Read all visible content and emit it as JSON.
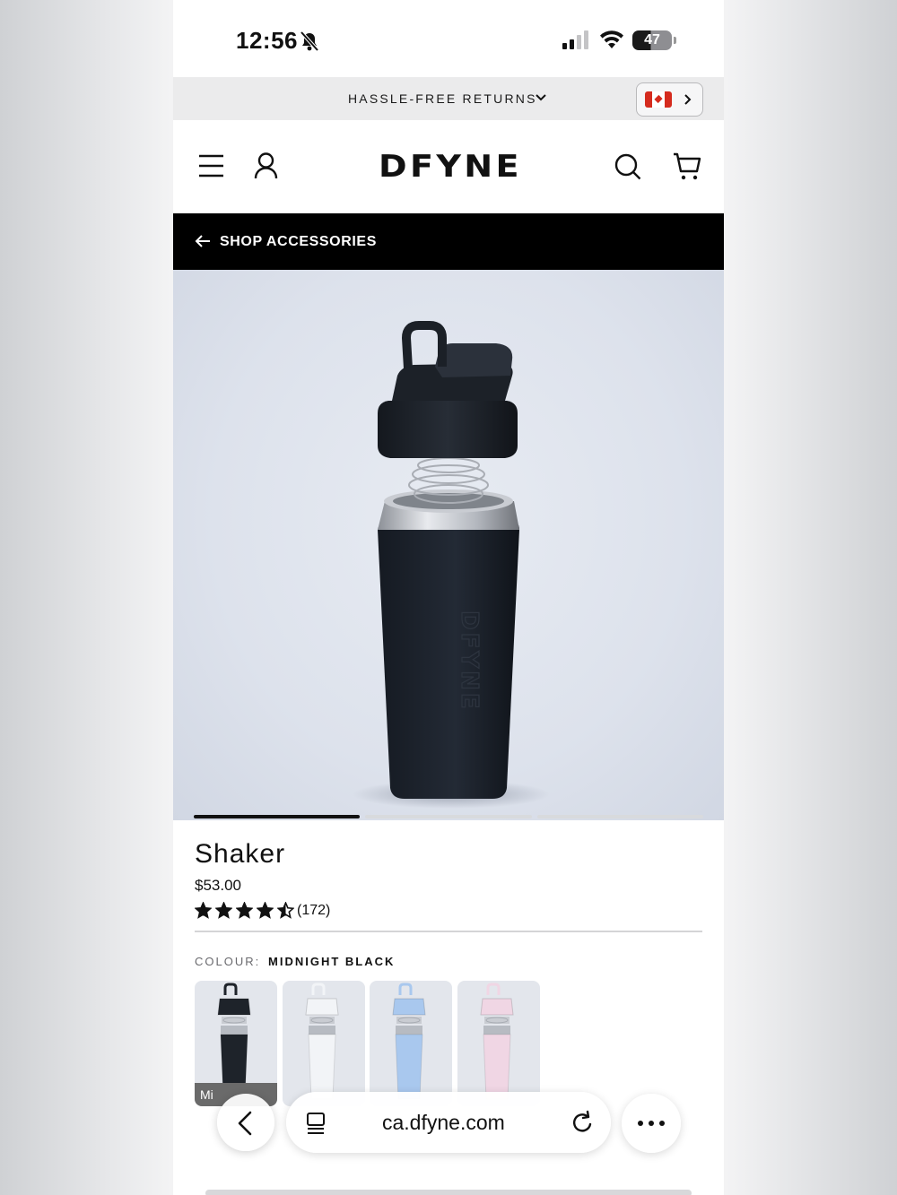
{
  "status_bar": {
    "time": "12:56",
    "battery": "47",
    "battery_level": 0.47,
    "icons": [
      "bell-slash-icon",
      "cellular-signal-icon",
      "wifi-icon",
      "battery-icon"
    ]
  },
  "promo_bar": {
    "text": "HASSLE-FREE RETURNS",
    "country_flag": "canada-flag-icon"
  },
  "header": {
    "logo": "DFYNE",
    "icons": [
      "menu-icon",
      "account-icon",
      "search-icon",
      "cart-icon"
    ]
  },
  "back_bar": {
    "label": "SHOP ACCESSORIES"
  },
  "gallery": {
    "slides": 3,
    "active_slide": 1
  },
  "product": {
    "title": "Shaker",
    "price": "$53.00",
    "rating": 4.5,
    "review_count": "(172)",
    "colour_label": "COLOUR:",
    "colour_value": "MIDNIGHT BLACK",
    "swatches": [
      {
        "caption": "Mi",
        "color": "#1e232a"
      },
      {
        "caption": "",
        "color": "#f2f4f7"
      },
      {
        "caption": "",
        "color": "#a9c8ee"
      },
      {
        "caption": "",
        "color": "#f0d6e4"
      }
    ]
  },
  "browser": {
    "url": "ca.dfyne.com"
  },
  "colors": {
    "black": "#000000",
    "hero_bg": "#dde2ec",
    "accent_red": "#d52b1e"
  }
}
